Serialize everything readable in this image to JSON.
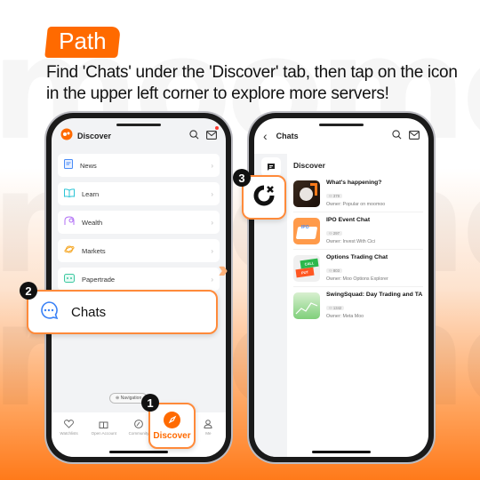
{
  "banner": {
    "tag": "Path",
    "instruction": "Find 'Chats' under the 'Discover' tab, then tap on the icon in the upper left corner to explore more servers!"
  },
  "colors": {
    "accent": "#ff6a00",
    "callout_border": "#ff8a3a"
  },
  "left_phone": {
    "header": {
      "title": "Discover",
      "icons": [
        "moomoo-logo-icon",
        "search-icon",
        "mail-icon"
      ]
    },
    "items": [
      {
        "label": "News",
        "icon": "news-icon"
      },
      {
        "label": "Learn",
        "icon": "book-icon"
      },
      {
        "label": "Wealth",
        "icon": "wealth-icon"
      },
      {
        "label": "Markets",
        "icon": "planet-icon"
      },
      {
        "label": "Papertrade",
        "icon": "gamepad-icon"
      }
    ],
    "nav_pill": "Navigation",
    "tabs": [
      {
        "label": "Watchlists",
        "icon": "heart-icon"
      },
      {
        "label": "Open Account",
        "icon": "gift-icon"
      },
      {
        "label": "Community",
        "icon": "community-icon"
      },
      {
        "label": "Discover",
        "icon": "compass-icon"
      },
      {
        "label": "Me",
        "icon": "person-icon"
      }
    ]
  },
  "callouts": {
    "step1": {
      "number": "1",
      "label": "Discover"
    },
    "step2": {
      "number": "2",
      "label": "Chats"
    },
    "step3": {
      "number": "3"
    }
  },
  "right_phone": {
    "header": {
      "title": "Chats"
    },
    "section_title": "Discover",
    "chats": [
      {
        "title": "What's happening?",
        "members": "379",
        "owner": "Owner: Popular on moomoo"
      },
      {
        "title": "IPO Event Chat",
        "members": "297",
        "owner": "Owner: Invest With Cici"
      },
      {
        "title": "Options Trading Chat",
        "members": "803",
        "owner": "Owner: Moo Options Explorer"
      },
      {
        "title": "SwingSquad: Day Trading and TA",
        "members": "1342",
        "owner": "Owner: Meta Moo"
      }
    ]
  }
}
